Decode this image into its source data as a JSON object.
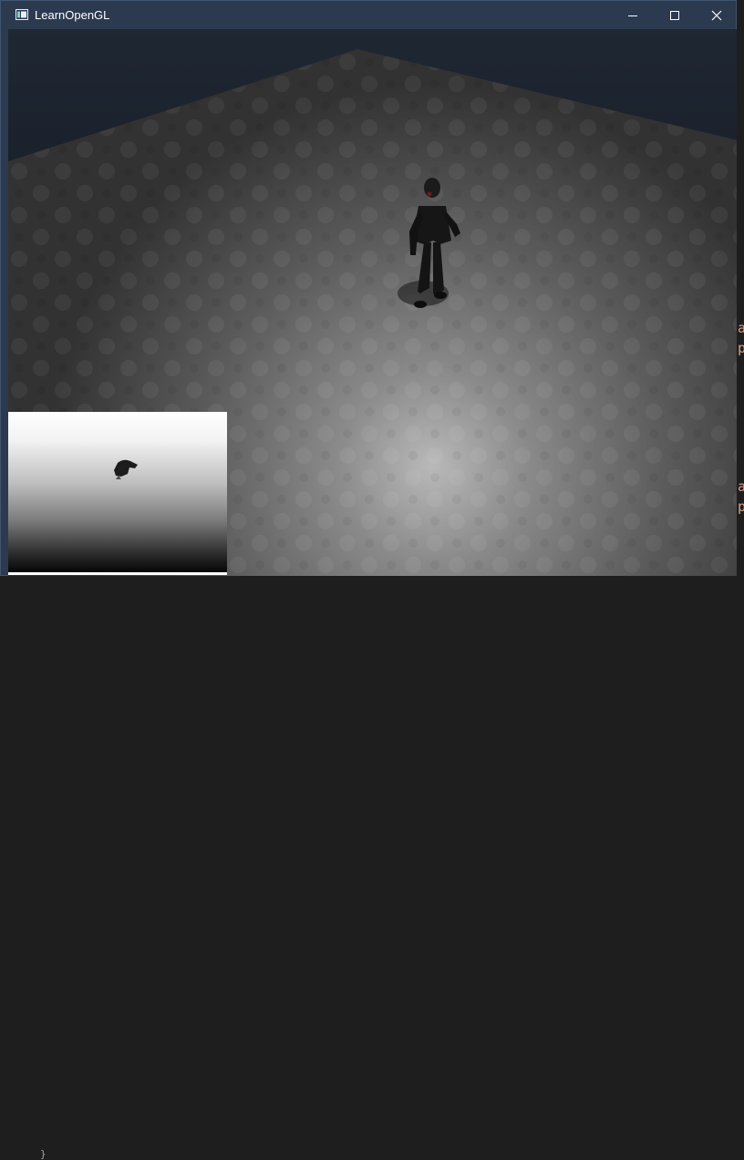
{
  "window": {
    "title": "LearnOpenGL",
    "icon": "app-window-icon"
  },
  "controls": {
    "minimize_icon": "minimize-icon",
    "maximize_icon": "maximize-icon",
    "close_icon": "close-icon"
  },
  "background_editor": {
    "glyphs": [
      "a",
      "p",
      "a",
      "p"
    ],
    "bottom_glyph": "}"
  },
  "colors": {
    "titlebar": "#2b3a4f",
    "floor": "#6b6b6b",
    "water": "#0f141a",
    "code_text": "#d69d85"
  }
}
